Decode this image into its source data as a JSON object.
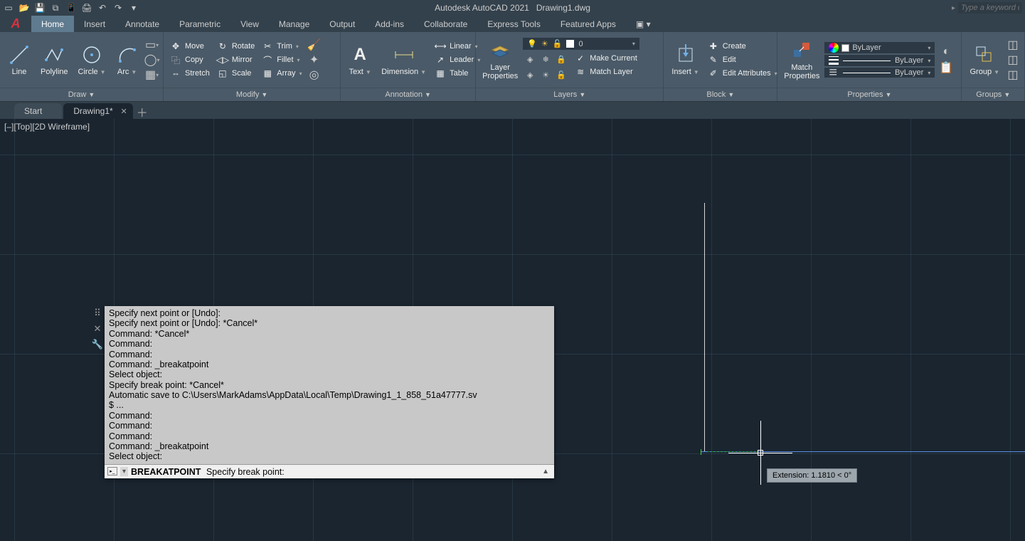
{
  "title": {
    "app": "Autodesk AutoCAD 2021",
    "file": "Drawing1.dwg"
  },
  "search_placeholder": "Type a keyword o",
  "menubar": [
    "Home",
    "Insert",
    "Annotate",
    "Parametric",
    "View",
    "Manage",
    "Output",
    "Add-ins",
    "Collaborate",
    "Express Tools",
    "Featured Apps"
  ],
  "ribbon": {
    "draw": {
      "title": "Draw",
      "line": "Line",
      "polyline": "Polyline",
      "circle": "Circle",
      "arc": "Arc"
    },
    "modify": {
      "title": "Modify",
      "move": "Move",
      "rotate": "Rotate",
      "trim": "Trim",
      "copy": "Copy",
      "mirror": "Mirror",
      "fillet": "Fillet",
      "stretch": "Stretch",
      "scale": "Scale",
      "array": "Array"
    },
    "annotation": {
      "title": "Annotation",
      "text": "Text",
      "dimension": "Dimension",
      "linear": "Linear",
      "leader": "Leader",
      "table": "Table"
    },
    "layers": {
      "title": "Layers",
      "layerprops": "Layer\nProperties",
      "current": "0",
      "makecurrent": "Make Current",
      "matchlayer": "Match Layer"
    },
    "block": {
      "title": "Block",
      "insert": "Insert",
      "create": "Create",
      "edit": "Edit",
      "editattr": "Edit Attributes"
    },
    "properties": {
      "title": "Properties",
      "match": "Match\nProperties",
      "bylayer": "ByLayer"
    },
    "groups": {
      "title": "Groups",
      "group": "Group"
    }
  },
  "doctabs": {
    "start": "Start",
    "drawing": "Drawing1*"
  },
  "viewlabel": "[–][Top][2D Wireframe]",
  "command": {
    "history": "Specify next point or [Undo]:\nSpecify next point or [Undo]: *Cancel*\nCommand: *Cancel*\nCommand:\nCommand:\nCommand: _breakatpoint\nSelect object:\nSpecify break point: *Cancel*\nAutomatic save to C:\\Users\\MarkAdams\\AppData\\Local\\Temp\\Drawing1_1_858_51a47777.sv\n$ ...\nCommand:\nCommand:\nCommand:\nCommand: _breakatpoint\nSelect object:",
    "active_cmd": "BREAKATPOINT",
    "prompt": "Specify break point:"
  },
  "tooltip": "Extension: 1.1810 < 0°"
}
